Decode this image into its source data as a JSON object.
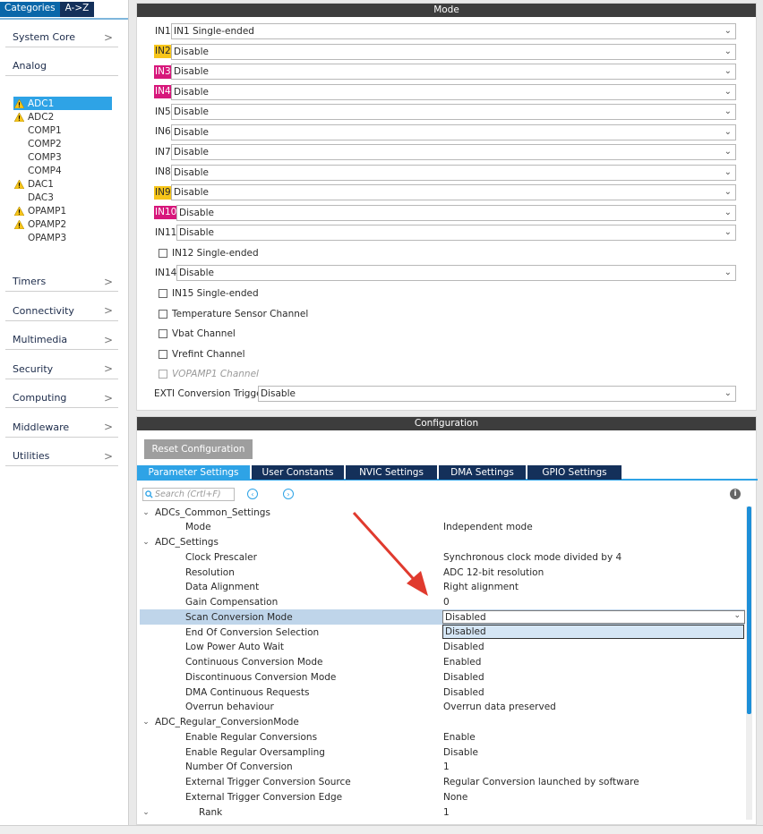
{
  "sidebar": {
    "tabs": {
      "categories": "Categories",
      "az": "A->Z"
    },
    "groups_top": [
      {
        "label": "System Core"
      },
      {
        "label": "Analog"
      }
    ],
    "peripherals": [
      {
        "name": "ADC1",
        "warning": true,
        "selected": true
      },
      {
        "name": "ADC2",
        "warning": true,
        "selected": false
      },
      {
        "name": "COMP1",
        "warning": false,
        "selected": false
      },
      {
        "name": "COMP2",
        "warning": false,
        "selected": false
      },
      {
        "name": "COMP3",
        "warning": false,
        "selected": false
      },
      {
        "name": "COMP4",
        "warning": false,
        "selected": false
      },
      {
        "name": "DAC1",
        "warning": true,
        "selected": false
      },
      {
        "name": "DAC3",
        "warning": false,
        "selected": false
      },
      {
        "name": "OPAMP1",
        "warning": true,
        "selected": false
      },
      {
        "name": "OPAMP2",
        "warning": true,
        "selected": false
      },
      {
        "name": "OPAMP3",
        "warning": false,
        "selected": false
      }
    ],
    "groups_bottom": [
      {
        "label": "Timers"
      },
      {
        "label": "Connectivity"
      },
      {
        "label": "Multimedia"
      },
      {
        "label": "Security"
      },
      {
        "label": "Computing"
      },
      {
        "label": "Middleware"
      },
      {
        "label": "Utilities"
      }
    ],
    "chevron": ">"
  },
  "mode": {
    "title": "Mode",
    "inputs": [
      {
        "label": "IN1",
        "value": "IN1 Single-ended",
        "highlight": "none"
      },
      {
        "label": "IN2",
        "value": "Disable",
        "highlight": "yellow"
      },
      {
        "label": "IN3",
        "value": "Disable",
        "highlight": "pink"
      },
      {
        "label": "IN4",
        "value": "Disable",
        "highlight": "pink"
      },
      {
        "label": "IN5",
        "value": "Disable",
        "highlight": "none"
      },
      {
        "label": "IN6",
        "value": "Disable",
        "highlight": "none"
      },
      {
        "label": "IN7",
        "value": "Disable",
        "highlight": "none"
      },
      {
        "label": "IN8",
        "value": "Disable",
        "highlight": "none"
      },
      {
        "label": "IN9",
        "value": "Disable",
        "highlight": "yellow"
      },
      {
        "label": "IN10",
        "value": "Disable",
        "highlight": "pink"
      },
      {
        "label": "IN11",
        "value": "Disable",
        "highlight": "none"
      }
    ],
    "cb_in12": "IN12 Single-ended",
    "in14": {
      "label": "IN14",
      "value": "Disable"
    },
    "checkboxes": [
      {
        "label": "IN15 Single-ended",
        "disabled": false
      },
      {
        "label": "Temperature Sensor Channel",
        "disabled": false
      },
      {
        "label": "Vbat Channel",
        "disabled": false
      },
      {
        "label": "Vrefint Channel",
        "disabled": false
      },
      {
        "label": "VOPAMP1 Channel",
        "disabled": true
      }
    ],
    "exti": {
      "label": "EXTI Conversion Trigger",
      "value": "Disable"
    }
  },
  "config": {
    "title": "Configuration",
    "reset_label": "Reset Configuration",
    "tabs": [
      "Parameter Settings",
      "User Constants",
      "NVIC Settings",
      "DMA Settings",
      "GPIO Settings"
    ],
    "active_tab": "Parameter Settings",
    "search_placeholder": "Search (Crtl+F)",
    "info": "i",
    "rows": [
      {
        "kind": "group",
        "name": "ADCs_Common_Settings",
        "expanded": true
      },
      {
        "kind": "param",
        "name": "Mode",
        "value": "Independent mode"
      },
      {
        "kind": "group",
        "name": "ADC_Settings",
        "expanded": true
      },
      {
        "kind": "param",
        "name": "Clock Prescaler",
        "value": "Synchronous clock mode divided by 4"
      },
      {
        "kind": "param",
        "name": "Resolution",
        "value": "ADC 12-bit resolution"
      },
      {
        "kind": "param",
        "name": "Data Alignment",
        "value": "Right alignment"
      },
      {
        "kind": "param",
        "name": "Gain Compensation",
        "value": "0"
      },
      {
        "kind": "param",
        "name": "Scan Conversion Mode",
        "value": "",
        "highlighted": true
      },
      {
        "kind": "param",
        "name": "End Of Conversion Selection",
        "value": ""
      },
      {
        "kind": "param",
        "name": "Low Power Auto Wait",
        "value": "Disabled"
      },
      {
        "kind": "param",
        "name": "Continuous Conversion Mode",
        "value": "Enabled"
      },
      {
        "kind": "param",
        "name": "Discontinuous Conversion Mode",
        "value": "Disabled"
      },
      {
        "kind": "param",
        "name": "DMA Continuous Requests",
        "value": "Disabled"
      },
      {
        "kind": "param",
        "name": "Overrun behaviour",
        "value": "Overrun data preserved"
      },
      {
        "kind": "group",
        "name": "ADC_Regular_ConversionMode",
        "expanded": true
      },
      {
        "kind": "param",
        "name": "Enable Regular Conversions",
        "value": "Enable"
      },
      {
        "kind": "param",
        "name": "Enable Regular Oversampling",
        "value": "Disable"
      },
      {
        "kind": "param",
        "name": "Number Of Conversion",
        "value": "1"
      },
      {
        "kind": "param",
        "name": "External Trigger Conversion Source",
        "value": "Regular Conversion launched by software"
      },
      {
        "kind": "param",
        "name": "External Trigger Conversion Edge",
        "value": "None"
      },
      {
        "kind": "subgroup",
        "name": "Rank",
        "value": "1",
        "expanded": true
      }
    ],
    "scan_select": {
      "value": "Disabled",
      "dropdown_option": "Disabled"
    }
  },
  "colors": {
    "accent": "#2ea3e6",
    "dark_tab": "#14305a",
    "warning": "#f7c51a",
    "pink": "#d7177b",
    "arrow": "#e03a2e"
  }
}
